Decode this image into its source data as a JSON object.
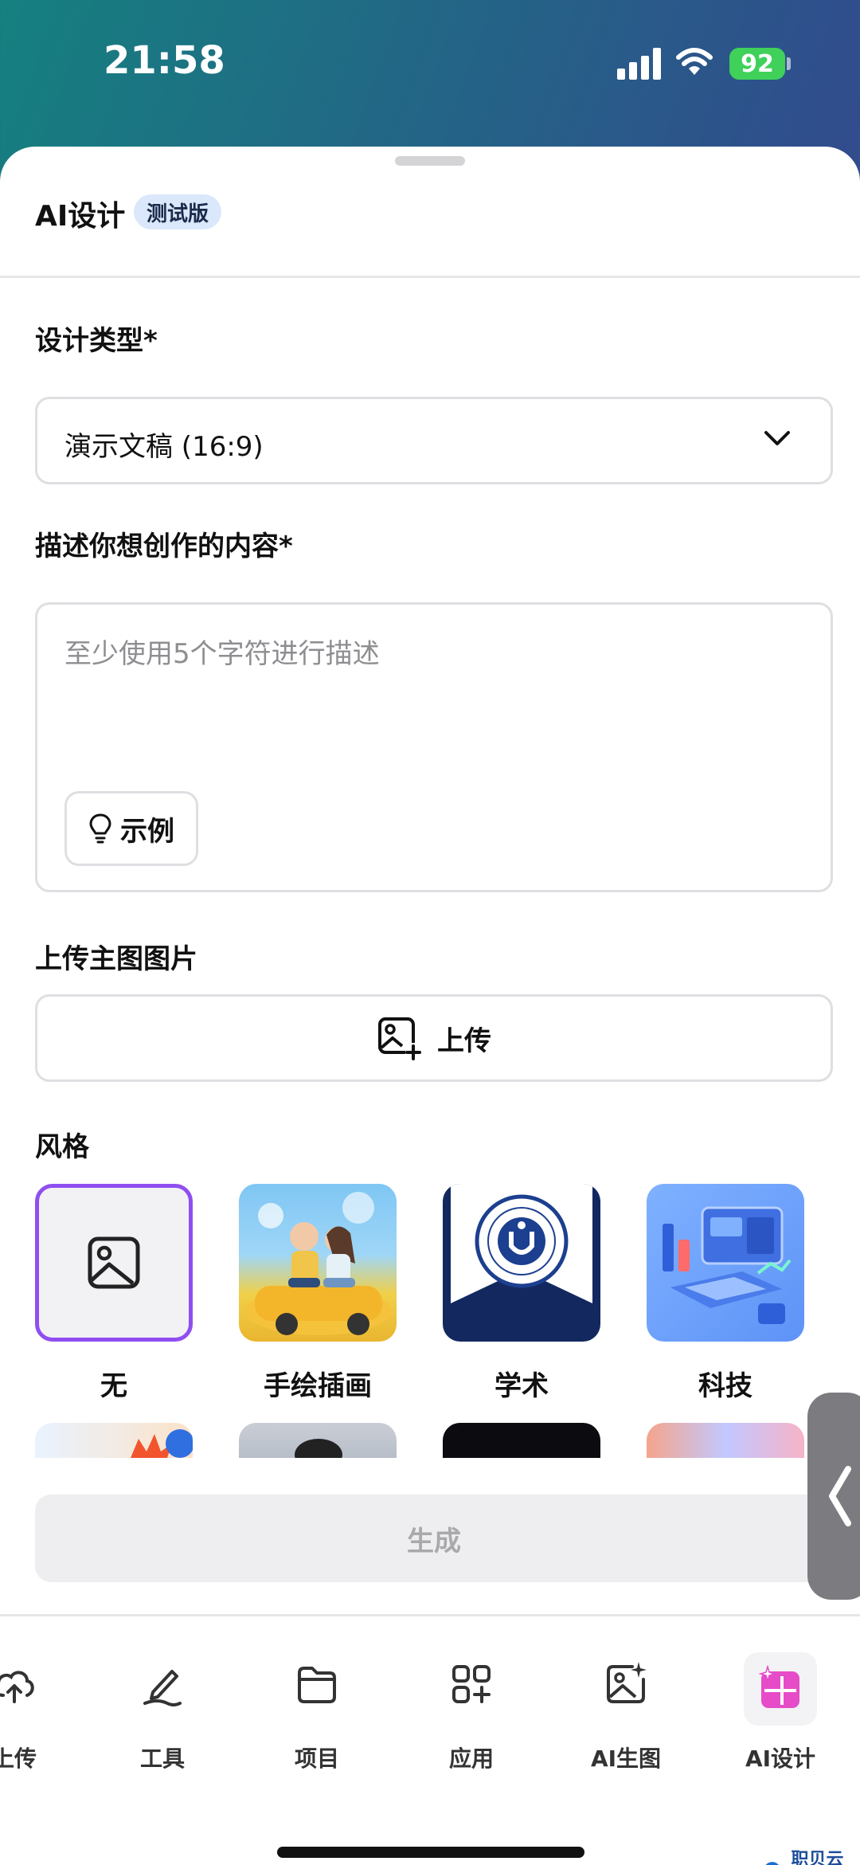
{
  "status_bar": {
    "time": "21:58",
    "battery": "92"
  },
  "header": {
    "title": "AI设计",
    "badge": "测试版"
  },
  "design_type": {
    "label": "设计类型*",
    "selected": "演示文稿 (16:9)"
  },
  "description": {
    "label": "描述你想创作的内容*",
    "placeholder": "至少使用5个字符进行描述",
    "example_label": "示例"
  },
  "upload": {
    "label": "上传主图图片",
    "button_label": "上传"
  },
  "style": {
    "label": "风格",
    "items": [
      {
        "label": "无",
        "selected": true
      },
      {
        "label": "手绘插画",
        "selected": false
      },
      {
        "label": "学术",
        "selected": false
      },
      {
        "label": "科技",
        "selected": false
      }
    ]
  },
  "generate": {
    "label": "生成"
  },
  "tabs": [
    {
      "label": "上传",
      "icon": "cloud-upload-icon"
    },
    {
      "label": "工具",
      "icon": "pen-tool-icon"
    },
    {
      "label": "项目",
      "icon": "folder-icon"
    },
    {
      "label": "应用",
      "icon": "apps-grid-icon"
    },
    {
      "label": "AI生图",
      "icon": "ai-image-icon"
    },
    {
      "label": "AI设计",
      "icon": "ai-design-icon",
      "active": true
    }
  ],
  "watermark": "职贝云数",
  "colors": {
    "accent": "#8f4ff0",
    "badge_bg": "#dbe8fb",
    "battery": "#3fd15a"
  }
}
